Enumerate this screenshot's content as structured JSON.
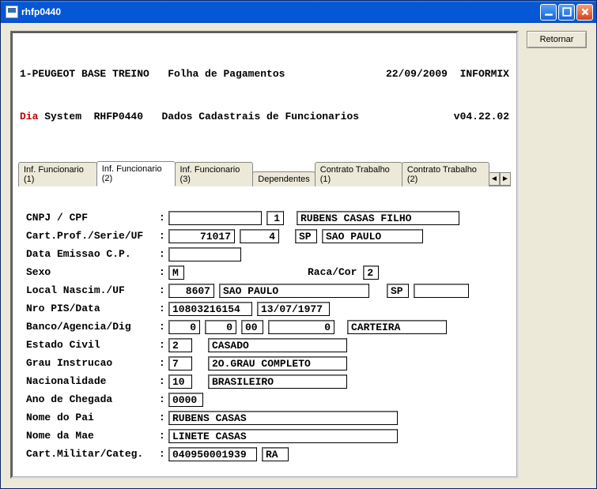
{
  "window": {
    "title": "rhfp0440"
  },
  "buttons": {
    "retornar": "Retornar"
  },
  "header": {
    "line1_left": "1-PEUGEOT BASE TREINO",
    "line1_mid": "Folha de Pagamentos",
    "line1_date": "22/09/2009",
    "line1_right": "INFORMIX",
    "line2_dia": "Dia",
    "line2_sys": " System  RHFP0440",
    "line2_mid": "Dados Cadastrais de Funcionarios",
    "line2_right": "v04.22.02"
  },
  "tabs": {
    "t1": "Inf. Funcionario (1)",
    "t2": "Inf. Funcionario (2)",
    "t3": "Inf. Funcionario (3)",
    "t4": "Dependentes",
    "t5": "Contrato Trabalho (1)",
    "t6": "Contrato Trabalho (2)"
  },
  "labels": {
    "cnpj": "CNPJ / CPF",
    "cart": "Cart.Prof./Serie/UF",
    "emissao": "Data Emissao C.P.",
    "sexo": "Sexo",
    "raca": "Raca/Cor",
    "local": "Local Nascim./UF",
    "pis": "Nro PIS/Data",
    "banco": "Banco/Agencia/Dig",
    "civil": "Estado Civil",
    "instr": "Grau Instrucao",
    "nac": "Nacionalidade",
    "chegada": "Ano de Chegada",
    "pai": "Nome do Pai",
    "mae": "Nome da Mae",
    "militar": "Cart.Militar/Categ."
  },
  "fields": {
    "cnpj_a": "",
    "cnpj_b": "1",
    "nome": "RUBENS CASAS FILHO",
    "cart_num": "71017",
    "cart_serie": "4",
    "cart_uf": "SP",
    "cart_cidade": "SAO PAULO",
    "emissao_val": "",
    "sexo": "M",
    "raca": "2",
    "local_cod": "8607",
    "local_cidade": "SAO PAULO",
    "local_uf": "SP",
    "local_extra": "",
    "pis_num": "10803216154",
    "pis_data": "13/07/1977",
    "banco_a": "0",
    "banco_b": "0",
    "banco_c": "00",
    "banco_d": "0",
    "banco_tipo": "CARTEIRA",
    "civil_cod": "2",
    "civil_desc": "CASADO",
    "instr_cod": "7",
    "instr_desc": "2O.GRAU COMPLETO",
    "nac_cod": "10",
    "nac_desc": "BRASILEIRO",
    "chegada": "0000",
    "pai": "RUBENS CASAS",
    "mae": "LINETE CASAS",
    "militar_num": "040950001939",
    "militar_cat": "RA"
  }
}
